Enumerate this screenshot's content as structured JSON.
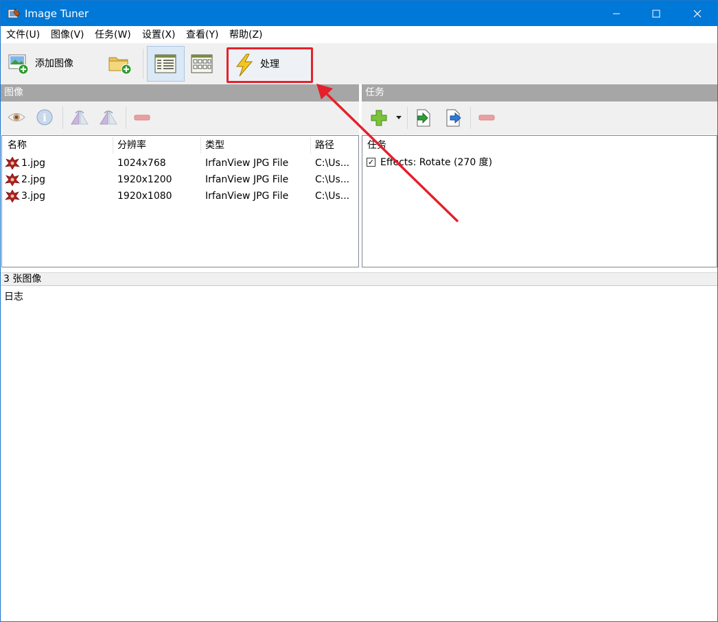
{
  "window": {
    "title": "Image Tuner"
  },
  "menu": {
    "file": "文件(U)",
    "image": "图像(V)",
    "task": "任务(W)",
    "settings": "设置(X)",
    "view": "查看(Y)",
    "help": "帮助(Z)"
  },
  "toolbar": {
    "add_image_label": "添加图像",
    "process_label": "处理"
  },
  "images_panel": {
    "header": "图像",
    "columns": [
      "名称",
      "分辨率",
      "类型",
      "路径"
    ],
    "rows": [
      {
        "name": "1.jpg",
        "resolution": "1024x768",
        "type": "IrfanView JPG File",
        "path": "C:\\Us..."
      },
      {
        "name": "2.jpg",
        "resolution": "1920x1200",
        "type": "IrfanView JPG File",
        "path": "C:\\Us..."
      },
      {
        "name": "3.jpg",
        "resolution": "1920x1080",
        "type": "IrfanView JPG File",
        "path": "C:\\Us..."
      }
    ]
  },
  "tasks_panel": {
    "header": "任务",
    "column": "任务",
    "items": [
      {
        "label": "Effects: Rotate (270 度)",
        "checked": true
      }
    ]
  },
  "status": {
    "count_text": "3 张图像"
  },
  "log": {
    "label": "日志"
  },
  "colors": {
    "titlebar": "#0078d7",
    "highlight": "#e5202a",
    "panel_header": "#a6a6a6"
  },
  "icons": [
    "app-icon",
    "add-image-icon",
    "add-folder-icon",
    "details-view-icon",
    "thumbnail-view-icon",
    "lightning-icon",
    "eye-icon",
    "info-icon",
    "flip-horizontal-icon",
    "flip-vertical-icon",
    "remove-icon",
    "add-task-icon",
    "import-task-icon",
    "export-task-icon",
    "remove-task-icon",
    "jpg-file-icon",
    "annotation-arrow"
  ]
}
